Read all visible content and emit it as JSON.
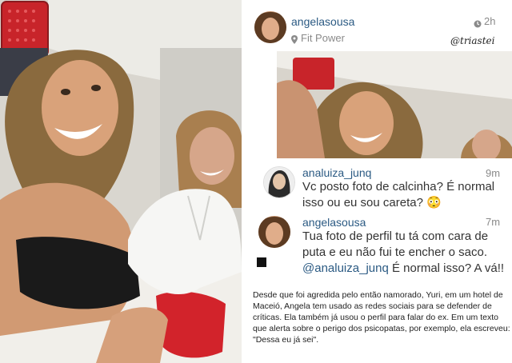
{
  "post": {
    "username": "angelasousa",
    "location": "Fit Power",
    "time": "2h",
    "watermark": "@triastei"
  },
  "comments": [
    {
      "username": "analuiza_junq",
      "time": "9m",
      "lines": [
        "Vc posto foto de calcinha? É normal",
        "isso ou eu sou careta? 😳"
      ]
    },
    {
      "username": "angelasousa",
      "time": "7m",
      "lines": [
        "Tua foto de perfil tu tá com cara de",
        "puta e eu não fui te encher o saco."
      ],
      "mention": "@analuiza_junq",
      "after_mention": " É normal isso? A vá!!"
    }
  ],
  "caption": "Desde que foi agredida pelo então namorado, Yuri, em um hotel de Maceió, Angela tem usado as redes sociais para se defender de críticas. Ela também já usou o perfil para falar do ex. Em um texto que alerta sobre o perigo dos psicopatas, por exemplo, ela escreveu: \"Dessa eu já sei\"."
}
